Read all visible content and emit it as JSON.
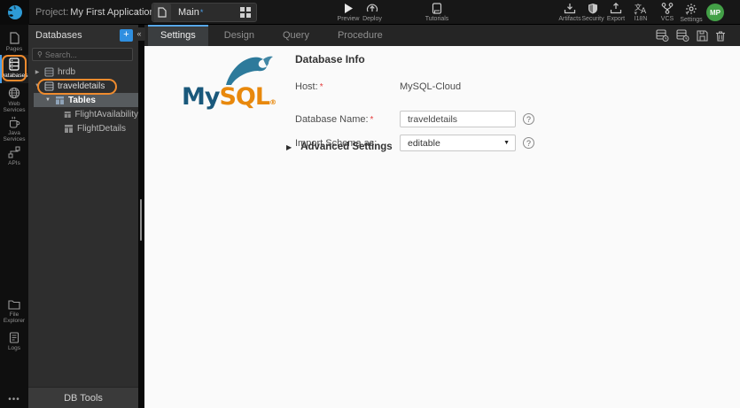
{
  "topbar": {
    "project_label": "Project:",
    "project_name": "My First Application",
    "breadcrumb_chevron": "›",
    "page_name": "Main",
    "unsaved_marker": "*",
    "preview_label": "Preview",
    "deploy_label": "Deploy",
    "tutorials_label": "Tutorials",
    "right_items": [
      {
        "label": "Artifacts"
      },
      {
        "label": "Security"
      },
      {
        "label": "Export"
      },
      {
        "label": "I18N"
      },
      {
        "label": "VCS"
      },
      {
        "label": "Settings"
      }
    ],
    "avatar_initials": "MP"
  },
  "rail": {
    "items": [
      {
        "label": "Pages"
      },
      {
        "label": "Databases"
      },
      {
        "label": "Web Services"
      },
      {
        "label": "Java Services"
      },
      {
        "label": "APIs"
      }
    ],
    "bottom_items": [
      {
        "label": "File Explorer"
      },
      {
        "label": "Logs"
      }
    ],
    "more_label": "•••"
  },
  "panel": {
    "title": "Databases",
    "add_label": "+",
    "collapse_glyph": "«",
    "search_placeholder": "Search...",
    "tree": [
      {
        "label": "hrdb"
      },
      {
        "label": "traveldetails"
      },
      {
        "label": "Tables"
      },
      {
        "label": "FlightAvailability"
      },
      {
        "label": "FlightDetails"
      }
    ],
    "footer": "DB Tools"
  },
  "tabs": {
    "items": [
      {
        "label": "Settings"
      },
      {
        "label": "Design"
      },
      {
        "label": "Query"
      },
      {
        "label": "Procedure"
      }
    ]
  },
  "content": {
    "heading": "Database Info",
    "host_label": "Host:",
    "required_marker": "*",
    "host_value": "MySQL-Cloud",
    "db_name_label": "Database Name:",
    "db_name_value": "traveldetails",
    "import_label": "Import Schema as:",
    "import_value": "editable",
    "help_glyph": "?",
    "advanced_label": "Advanced Settings",
    "logo_my": "My",
    "logo_sql": "SQL",
    "logo_reg": "®"
  },
  "colors": {
    "accent_blue": "#4a9fe8",
    "annotation_orange": "#ef8b2e",
    "mysql_blue": "#19587b",
    "mysql_orange": "#e8880c",
    "avatar_green": "#43a047"
  }
}
